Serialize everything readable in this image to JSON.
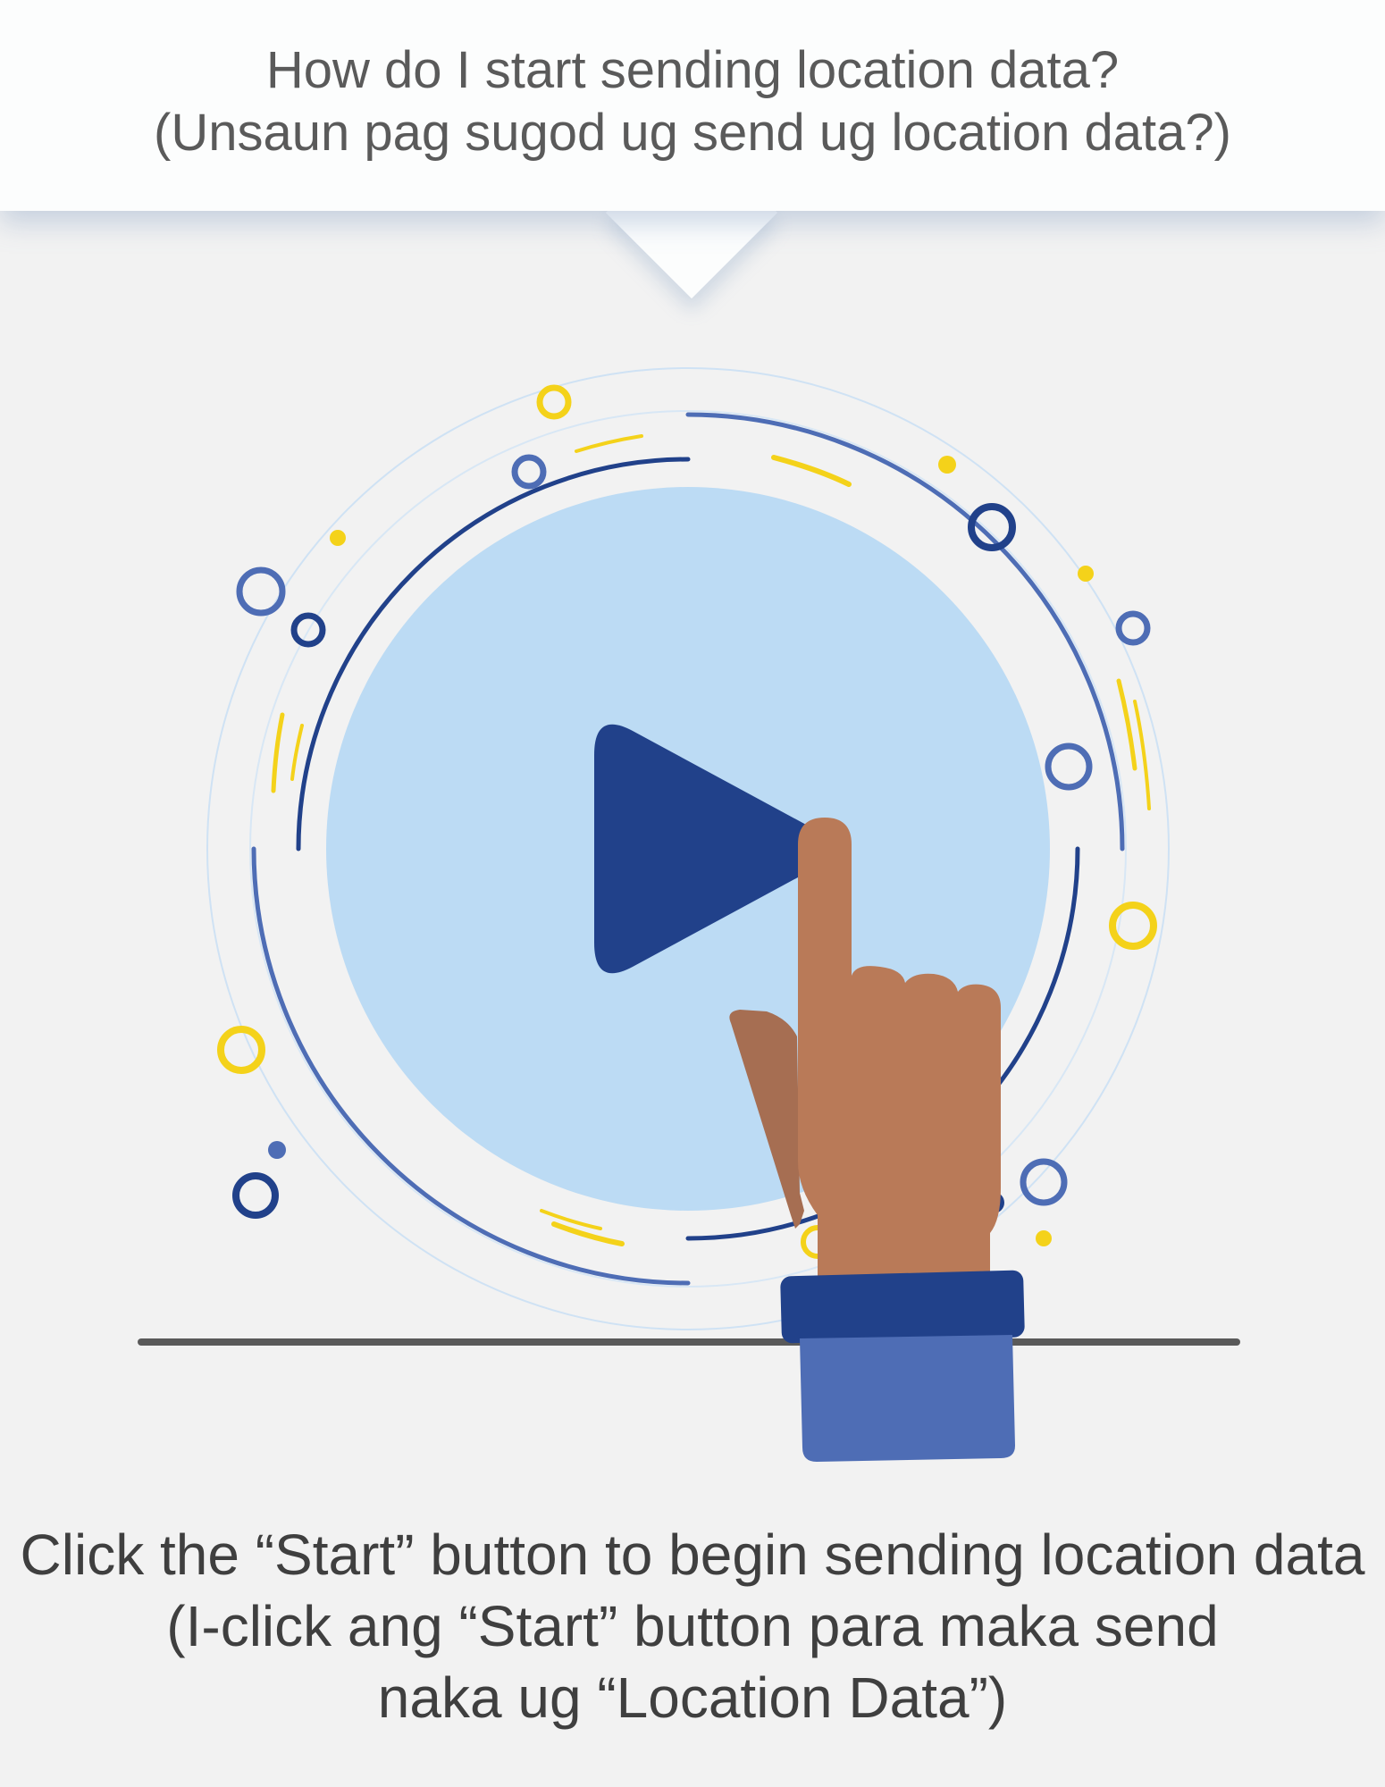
{
  "header": {
    "question_en": "How do I start sending location data?",
    "question_ceb": "(Unsaun pag sugod ug send ug location data?)"
  },
  "illustration": {
    "button_icon": "play-icon",
    "hand_icon": "pointing-hand-icon",
    "colors": {
      "background": "#f2f2f2",
      "button_face": "#bcdbf4",
      "play_triangle": "#21418a",
      "ring_dark": "#21418a",
      "ring_mid": "#4e6db5",
      "accent_yellow": "#f4d21a",
      "skin": "#b97a58",
      "cuff_dark": "#21418a",
      "sleeve": "#4e6db5"
    }
  },
  "instruction": {
    "line1": "Click the “Start” button to begin sending location data",
    "line2": "(I-click ang “Start” button para maka send",
    "line3": "naka ug “Location Data”)"
  }
}
